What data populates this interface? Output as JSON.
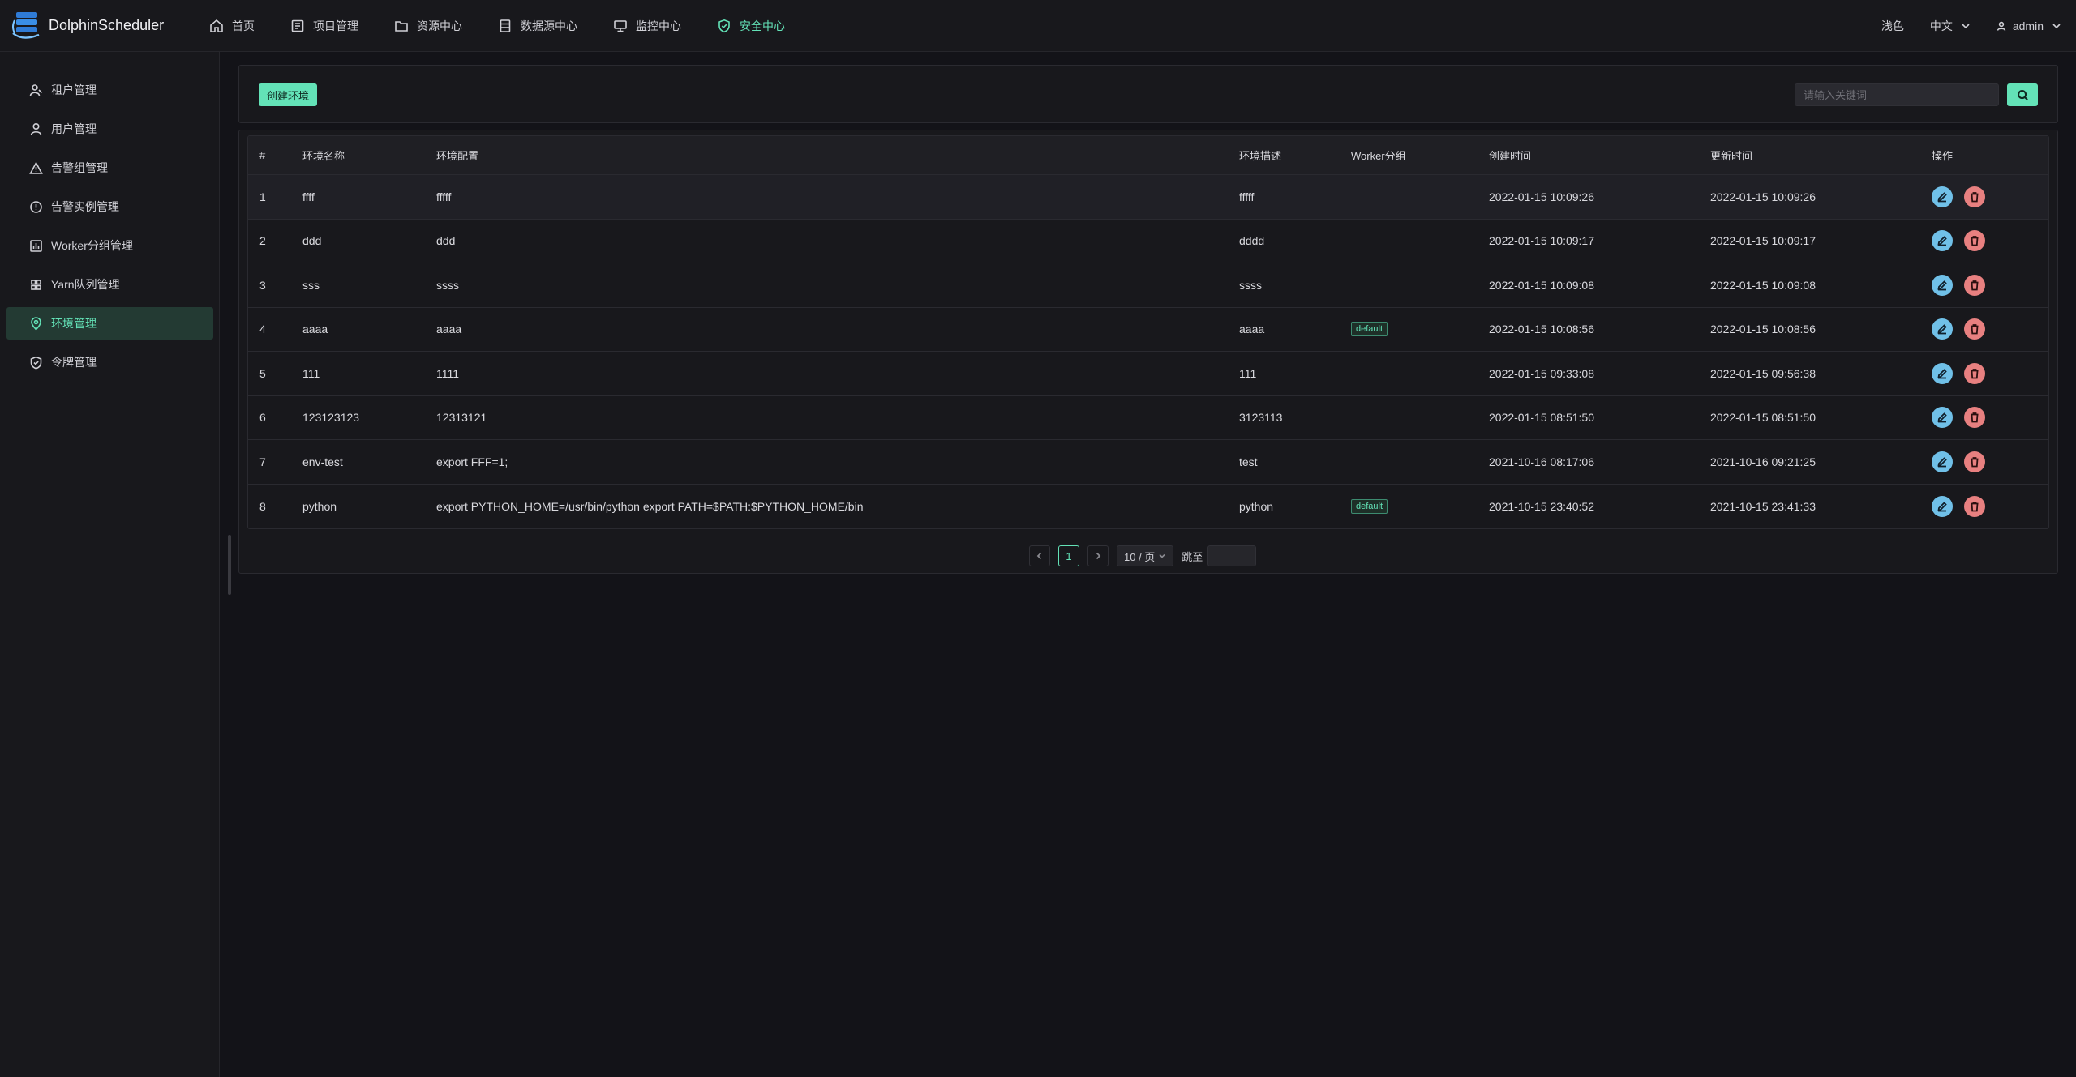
{
  "header": {
    "logo_text": "DolphinScheduler",
    "nav": [
      {
        "label": "首页",
        "icon": "home-icon",
        "active": false
      },
      {
        "label": "项目管理",
        "icon": "project-icon",
        "active": false
      },
      {
        "label": "资源中心",
        "icon": "folder-icon",
        "active": false
      },
      {
        "label": "数据源中心",
        "icon": "database-icon",
        "active": false
      },
      {
        "label": "监控中心",
        "icon": "monitor-icon",
        "active": false
      },
      {
        "label": "安全中心",
        "icon": "shield-icon",
        "active": true
      }
    ],
    "theme_label": "浅色",
    "language": "中文",
    "user": "admin"
  },
  "sidebar": {
    "items": [
      {
        "label": "租户管理",
        "icon": "tenant-icon",
        "active": false
      },
      {
        "label": "用户管理",
        "icon": "user-icon",
        "active": false
      },
      {
        "label": "告警组管理",
        "icon": "alert-group-icon",
        "active": false
      },
      {
        "label": "告警实例管理",
        "icon": "alert-instance-icon",
        "active": false
      },
      {
        "label": "Worker分组管理",
        "icon": "worker-group-icon",
        "active": false
      },
      {
        "label": "Yarn队列管理",
        "icon": "yarn-queue-icon",
        "active": false
      },
      {
        "label": "环境管理",
        "icon": "environment-icon",
        "active": true
      },
      {
        "label": "令牌管理",
        "icon": "token-icon",
        "active": false
      }
    ]
  },
  "toolbar": {
    "create_label": "创建环境",
    "search_placeholder": "请输入关键词"
  },
  "table": {
    "columns": [
      "#",
      "环境名称",
      "环境配置",
      "环境描述",
      "Worker分组",
      "创建时间",
      "更新时间",
      "操作"
    ],
    "rows": [
      {
        "index": "1",
        "name": "ffff",
        "config": "fffff",
        "desc": "fffff",
        "worker_group": "",
        "created": "2022-01-15 10:09:26",
        "updated": "2022-01-15 10:09:26"
      },
      {
        "index": "2",
        "name": "ddd",
        "config": "ddd",
        "desc": "dddd",
        "worker_group": "",
        "created": "2022-01-15 10:09:17",
        "updated": "2022-01-15 10:09:17"
      },
      {
        "index": "3",
        "name": "sss",
        "config": "ssss",
        "desc": "ssss",
        "worker_group": "",
        "created": "2022-01-15 10:09:08",
        "updated": "2022-01-15 10:09:08"
      },
      {
        "index": "4",
        "name": "aaaa",
        "config": "aaaa",
        "desc": "aaaa",
        "worker_group": "default",
        "created": "2022-01-15 10:08:56",
        "updated": "2022-01-15 10:08:56"
      },
      {
        "index": "5",
        "name": "111",
        "config": "1111",
        "desc": "111",
        "worker_group": "",
        "created": "2022-01-15 09:33:08",
        "updated": "2022-01-15 09:56:38"
      },
      {
        "index": "6",
        "name": "123123123",
        "config": "12313121",
        "desc": "3123113",
        "worker_group": "",
        "created": "2022-01-15 08:51:50",
        "updated": "2022-01-15 08:51:50"
      },
      {
        "index": "7",
        "name": "env-test",
        "config": "export FFF=1;",
        "desc": "test",
        "worker_group": "",
        "created": "2021-10-16 08:17:06",
        "updated": "2021-10-16 09:21:25"
      },
      {
        "index": "8",
        "name": "python",
        "config": "export PYTHON_HOME=/usr/bin/python export PATH=$PATH:$PYTHON_HOME/bin",
        "desc": "python",
        "worker_group": "default",
        "created": "2021-10-15 23:40:52",
        "updated": "2021-10-15 23:41:33"
      }
    ]
  },
  "pagination": {
    "current_page": "1",
    "page_size": "10 / 页",
    "jump_label": "跳至",
    "jump_value": ""
  },
  "colors": {
    "accent": "#63e2b7",
    "edit": "#70c0e8",
    "delete": "#e88080",
    "background": "#131318",
    "panel": "#18181c"
  }
}
